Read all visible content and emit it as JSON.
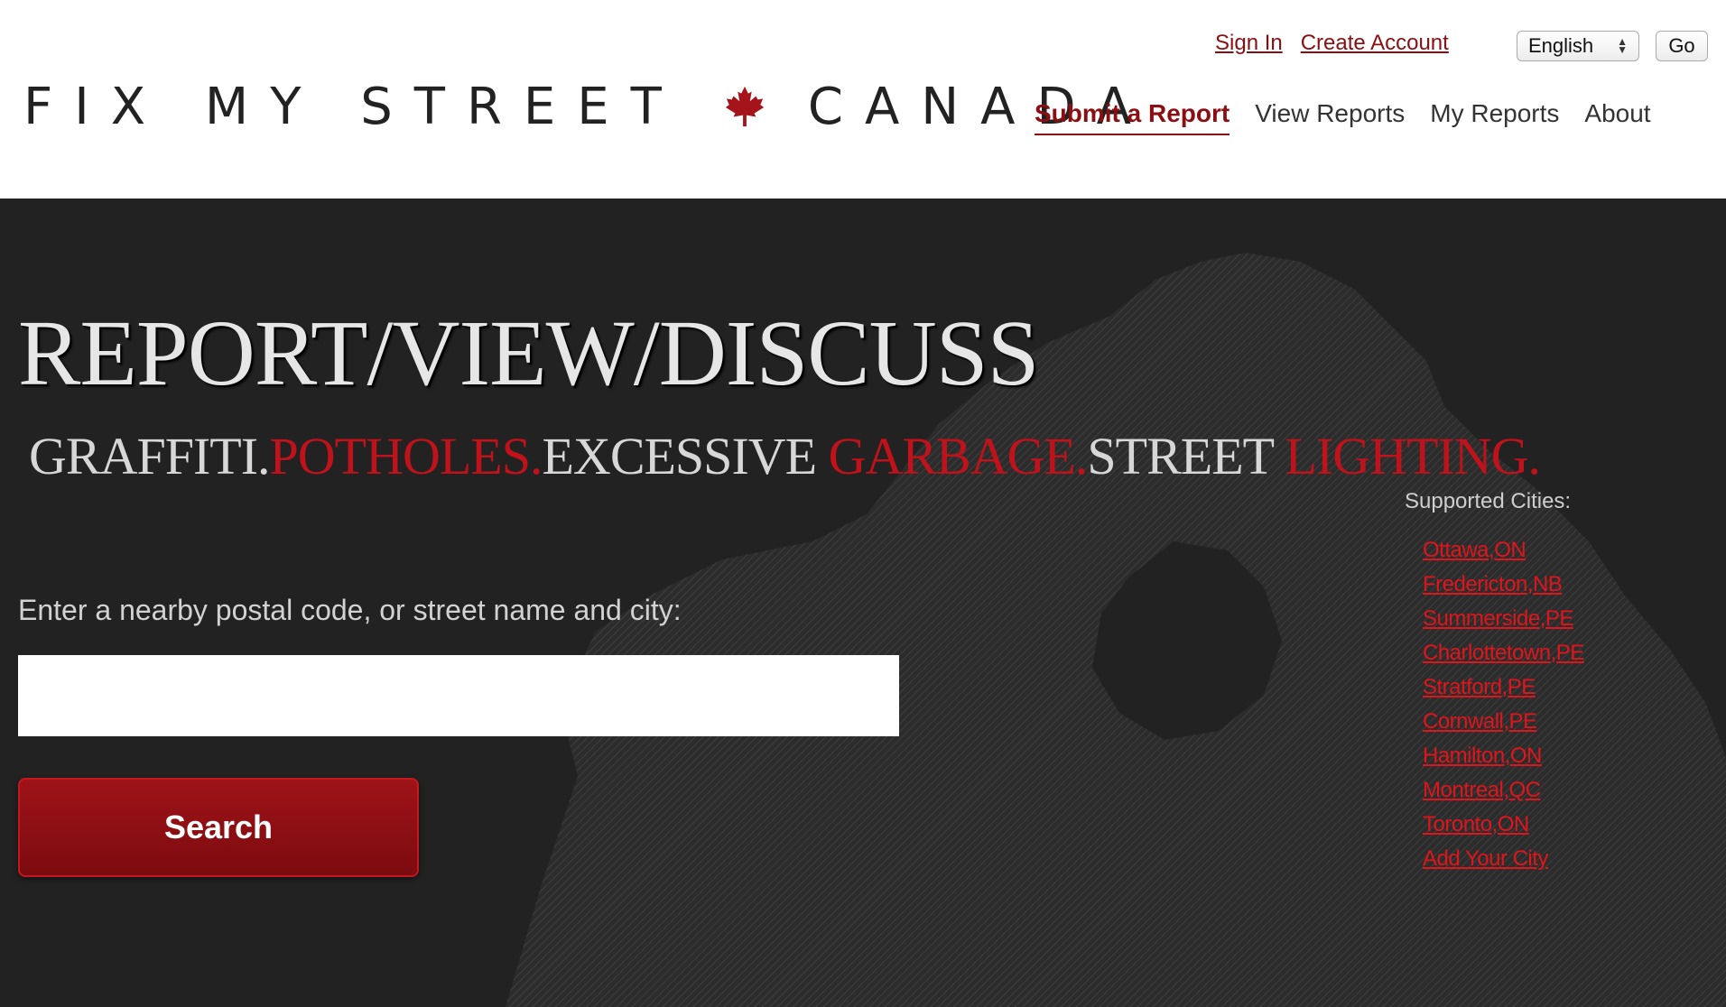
{
  "header": {
    "logo_left": "FIX MY STREET",
    "logo_right": "CANADA",
    "sign_in": "Sign In",
    "create_account": "Create Account",
    "language": "English",
    "go": "Go"
  },
  "nav": {
    "items": [
      {
        "label": "Submit a Report",
        "active": true
      },
      {
        "label": "View Reports",
        "active": false
      },
      {
        "label": "My Reports",
        "active": false
      },
      {
        "label": "About",
        "active": false
      }
    ]
  },
  "hero": {
    "headline": "REPORT/VIEW/DISCUSS",
    "tagline": {
      "w1": "GRAFFITI.",
      "r1": "POTHOLES.",
      "w2": "EXCESSIVE",
      "r2": "GARBAGE.",
      "w3": "STREET",
      "r3": "LIGHTING."
    },
    "search_label": "Enter a nearby postal code, or street name and city:",
    "search_value": "",
    "search_button": "Search"
  },
  "cities": {
    "heading": "Supported Cities:",
    "items": [
      "Ottawa,ON",
      "Fredericton,NB",
      "Summerside,PE",
      "Charlottetown,PE",
      "Stratford,PE",
      "Cornwall,PE",
      "Hamilton,ON",
      "Montreal,QC",
      "Toronto,ON",
      "Add Your City"
    ]
  },
  "colors": {
    "brand_red": "#8b0f12",
    "accent_red": "#c0121a",
    "hero_bg": "#222222"
  },
  "icons": {
    "logo_mark": "maple-leaf-icon"
  }
}
